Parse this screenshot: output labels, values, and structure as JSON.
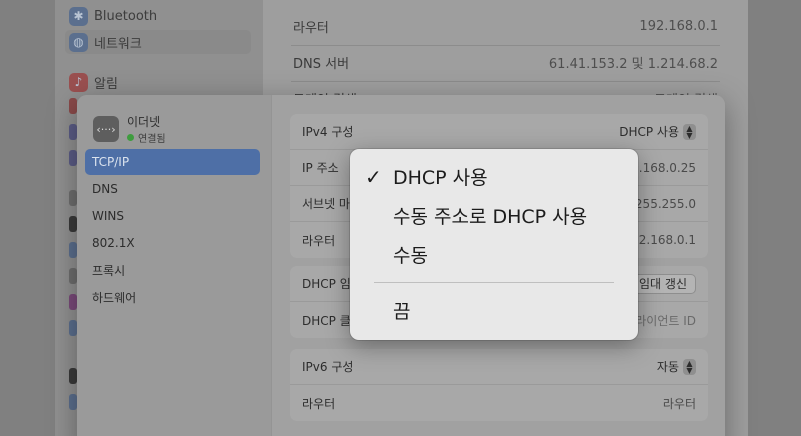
{
  "background_window": {
    "sidebar": {
      "bluetooth": "Bluetooth",
      "network": "네트워크",
      "notifications": "알림"
    },
    "rows": [
      {
        "label": "라우터",
        "value": "192.168.0.1"
      },
      {
        "label": "DNS 서버",
        "value": "61.41.153.2 및 1.214.68.2"
      },
      {
        "label": "도메인 검색",
        "value": "도메인 검색"
      }
    ]
  },
  "sheet": {
    "interface": {
      "name": "이더넷",
      "status": "연결됨"
    },
    "nav": [
      "TCP/IP",
      "DNS",
      "WINS",
      "802.1X",
      "프록시",
      "하드웨어"
    ],
    "selected_nav": "TCP/IP",
    "ipv4_group": {
      "config_label": "IPv4 구성",
      "config_value": "DHCP 사용",
      "ip_label": "IP 주소",
      "ip_value": "192.168.0.25",
      "subnet_label": "서브넷 마스크",
      "subnet_value": "255.255.255.0",
      "router_label": "라우터",
      "router_value": "192.168.0.1"
    },
    "dhcp_group": {
      "lease_label": "DHCP 임대",
      "renew_button": "임대 갱신",
      "client_label": "DHCP 클라이언트 ID",
      "client_placeholder": "DHCP 클라이언트 ID"
    },
    "ipv6_group": {
      "config_label": "IPv6 구성",
      "config_value": "자동",
      "router_label": "라우터",
      "router_value": "라우터"
    }
  },
  "menu": {
    "items": [
      "DHCP 사용",
      "수동 주소로 DHCP 사용",
      "수동"
    ],
    "checked": "DHCP 사용",
    "off_item": "끔"
  },
  "colors": {
    "accent_selected": "#4e6fa6",
    "status_connected": "#3e9c3e"
  }
}
